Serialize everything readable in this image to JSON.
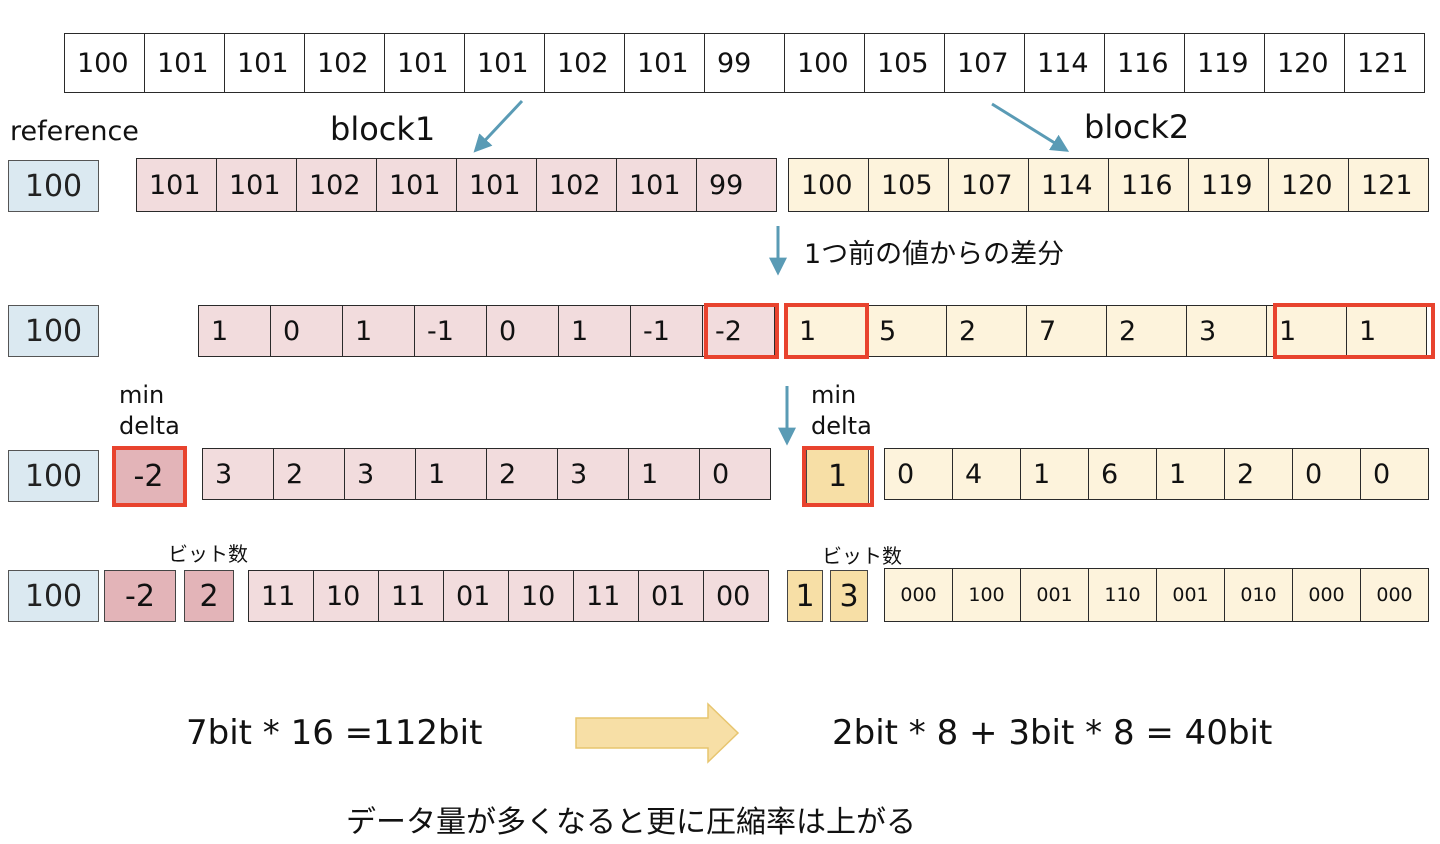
{
  "original_values": [
    "100",
    "101",
    "101",
    "102",
    "101",
    "101",
    "102",
    "101",
    "99",
    "100",
    "105",
    "107",
    "114",
    "116",
    "119",
    "120",
    "121"
  ],
  "labels": {
    "reference": "reference",
    "block1": "block1",
    "block2": "block2",
    "diff_caption": "1つ前の値からの差分",
    "min_delta_line1": "min",
    "min_delta_line2": "delta",
    "bit_count": "ビット数"
  },
  "reference_value": "100",
  "block1": {
    "values": [
      "101",
      "101",
      "102",
      "101",
      "101",
      "102",
      "101",
      "99"
    ],
    "deltas": [
      "1",
      "0",
      "1",
      "-1",
      "0",
      "1",
      "-1",
      "-2"
    ],
    "min_delta": "-2",
    "offsets": [
      "3",
      "2",
      "3",
      "1",
      "2",
      "3",
      "1",
      "0"
    ],
    "bit_width": "2",
    "bits": [
      "11",
      "10",
      "11",
      "01",
      "10",
      "11",
      "01",
      "00"
    ]
  },
  "block2": {
    "values": [
      "100",
      "105",
      "107",
      "114",
      "116",
      "119",
      "120",
      "121"
    ],
    "deltas": [
      "1",
      "5",
      "2",
      "7",
      "2",
      "3",
      "1",
      "1"
    ],
    "min_delta": "1",
    "offsets": [
      "0",
      "4",
      "1",
      "6",
      "1",
      "2",
      "0",
      "0"
    ],
    "bit_width": "3",
    "bits": [
      "000",
      "100",
      "001",
      "110",
      "001",
      "010",
      "000",
      "000"
    ]
  },
  "summary": {
    "before": "7bit * 16 =112bit",
    "after": "2bit * 8 + 3bit * 8 = 40bit",
    "note": "データ量が多くなると更に圧縮率は上がる"
  },
  "colors": {
    "block1_fill": "#f2dcdd",
    "block2_fill": "#fdf3dc",
    "reference_fill": "#dbe9f1",
    "highlight": "#e8432e",
    "arrow": "#5a9bb5",
    "big_arrow": "#f7dfa6"
  }
}
